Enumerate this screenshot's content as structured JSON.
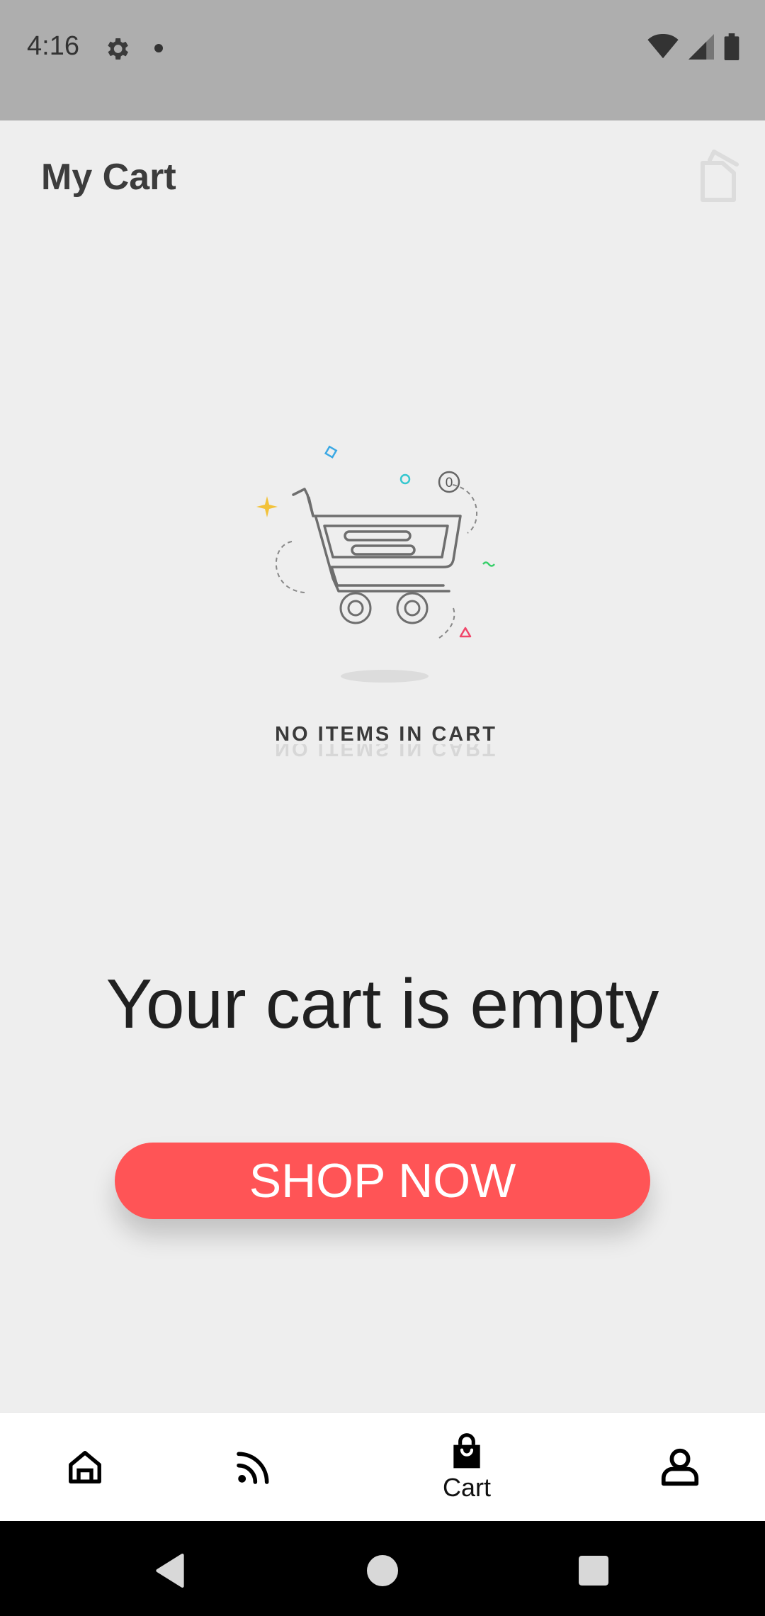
{
  "status_bar": {
    "time": "4:16",
    "icons": [
      "gear-icon",
      "notification-dot-icon",
      "wifi-icon",
      "signal-icon",
      "battery-icon"
    ]
  },
  "header": {
    "title": "My Cart",
    "icon": "clear-cart-icon"
  },
  "empty_state": {
    "illustration_caption": "NO ITEMS IN CART",
    "badge_count": "0",
    "heading": "Your cart is empty",
    "cta_label": "SHOP NOW"
  },
  "bottom_nav": {
    "items": [
      {
        "icon": "home-icon",
        "label": ""
      },
      {
        "icon": "feed-icon",
        "label": ""
      },
      {
        "icon": "shopping-bag-icon",
        "label": "Cart"
      },
      {
        "icon": "profile-icon",
        "label": ""
      }
    ],
    "active_index": 2
  },
  "system_nav": {
    "icons": [
      "back-icon",
      "home-circle-icon",
      "recents-icon"
    ]
  },
  "colors": {
    "accent": "#ff5456",
    "background": "#eeeeee",
    "status_bar": "#aeaeae"
  }
}
